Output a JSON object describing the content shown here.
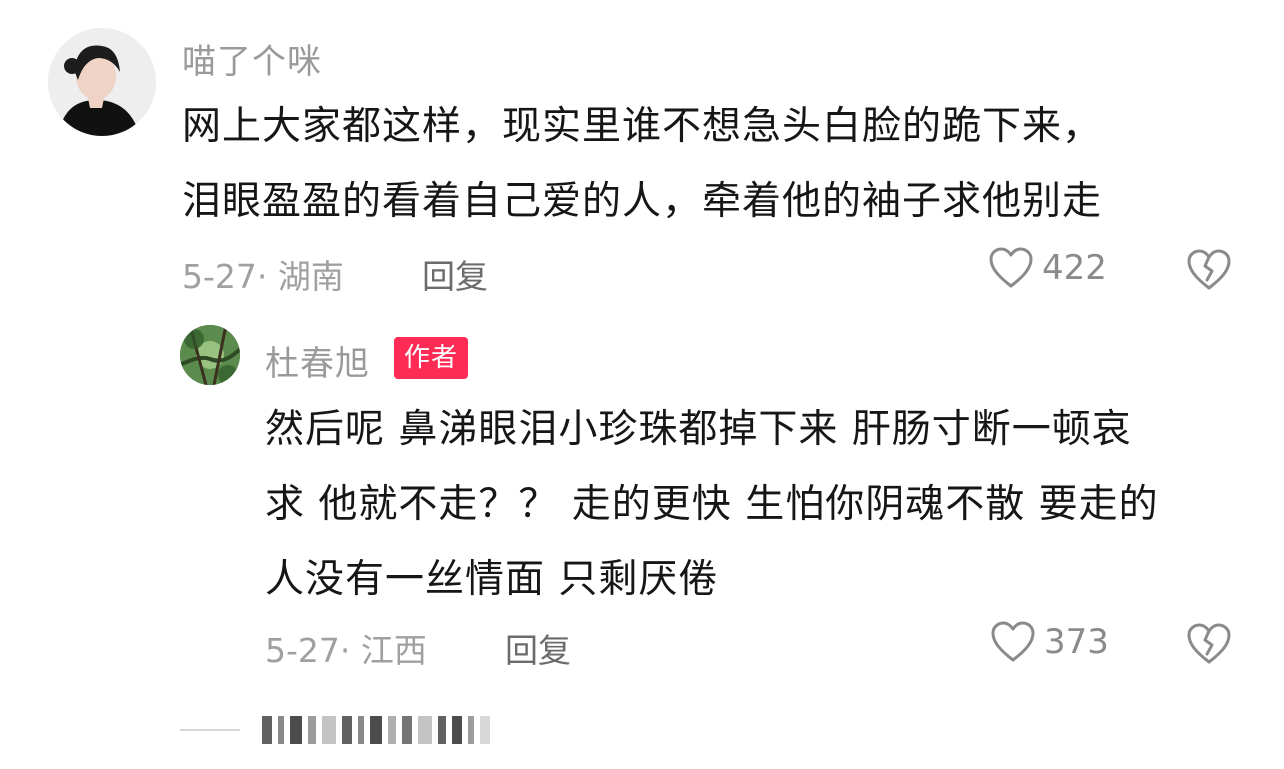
{
  "comment": {
    "username": "喵了个咪",
    "text_lines": [
      "网上大家都这样，现实里谁不想急头白脸的跪下来，",
      "泪眼盈盈的看着自己爱的人，牵着他的袖子求他别走"
    ],
    "meta": "5-27· 湖南",
    "reply_label": "回复",
    "like_count": "422",
    "like_icon": "heart-outline-icon",
    "dislike_icon": "broken-heart-icon"
  },
  "reply": {
    "username": "杜春旭",
    "badge": "作者",
    "text_lines": [
      "然后呢 鼻涕眼泪小珍珠都掉下来 肝肠寸断一顿哀",
      "求 他就不走？？ 走的更快 生怕你阴魂不散 要走的",
      "人没有一丝情面 只剩厌倦"
    ],
    "meta": "5-27· 江西",
    "reply_label": "回复",
    "like_count": "373",
    "like_icon": "heart-outline-icon",
    "dislike_icon": "broken-heart-icon"
  },
  "colors": {
    "badge": "#fe2c55",
    "muted": "#9a9a9a",
    "text": "#161616"
  }
}
